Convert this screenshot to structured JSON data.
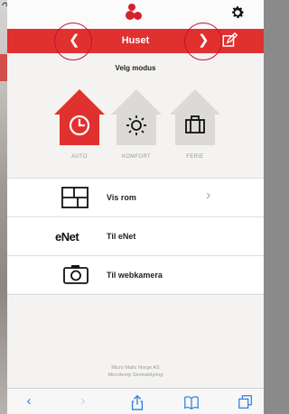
{
  "app": {
    "logo_text": "MICRO MATIC",
    "header_title": "Huset"
  },
  "mode": {
    "title": "Velg modus",
    "options": [
      {
        "label": "AUTO",
        "icon": "clock-icon",
        "active": true
      },
      {
        "label": "KOMFORT",
        "icon": "sun-icon",
        "active": false
      },
      {
        "label": "FERIE",
        "icon": "suitcase-icon",
        "active": false
      }
    ]
  },
  "menu": {
    "items": [
      {
        "label": "Vis rom",
        "icon": "floorplan-icon"
      },
      {
        "label": "Til eNet",
        "icon": "enet-logo-icon",
        "logo_text": "eNet"
      },
      {
        "label": "Til webkamera",
        "icon": "camera-icon"
      }
    ]
  },
  "footer": {
    "line1": "Micro Matic Norge AS",
    "line2": "Microtemp Sentralstyring"
  },
  "colors": {
    "accent_red": "#e0312f",
    "inactive_house": "#dcdad8",
    "ios_blue": "#2f7fe0"
  }
}
